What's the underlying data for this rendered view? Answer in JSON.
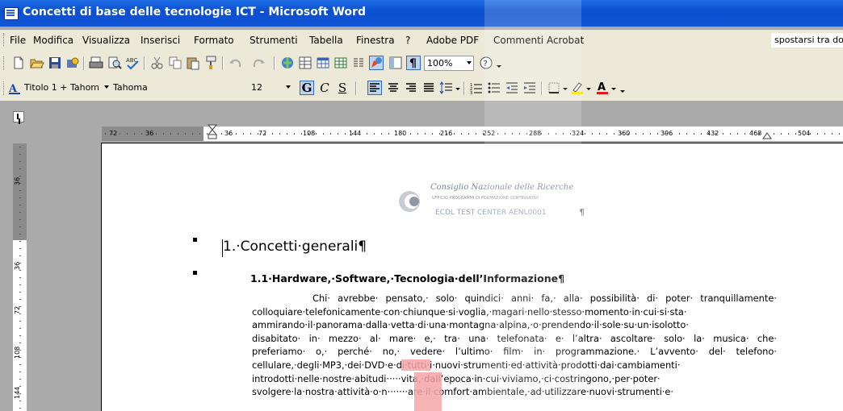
{
  "window": {
    "title": "Concetti di base delle tecnologie ICT - Microsoft Word"
  },
  "menubar": {
    "items": [
      "File",
      "Modifica",
      "Visualizza",
      "Inserisci",
      "Formato",
      "Strumenti",
      "Tabella",
      "Finestra",
      "?",
      "Adobe PDF",
      "Commenti Acrobat"
    ],
    "help_box": "spostarsi tra do"
  },
  "toolbar_standard": {
    "icons": [
      "new-icon",
      "open-icon",
      "save-icon",
      "permission-icon",
      "print-icon",
      "print-preview-icon",
      "spelling-icon",
      "cut-icon",
      "copy-icon",
      "paste-icon",
      "format-painter-icon",
      "undo-icon",
      "redo-icon",
      "hyperlink-icon",
      "tables-borders-icon",
      "insert-table-icon",
      "insert-excel-icon",
      "columns-icon",
      "drawing-icon",
      "document-map-icon",
      "show-formatting-icon",
      "help-icon"
    ],
    "zoom": "100%"
  },
  "toolbar_formatting": {
    "style": "Titolo 1 + Tahom",
    "font": "Tahoma",
    "size": "12",
    "bold_label": "G",
    "italic_label": "C",
    "underline_label": "S"
  },
  "rulers": {
    "horizontal": [
      "72",
      "36",
      "36",
      "72",
      "108",
      "144",
      "180",
      "216",
      "252",
      "288",
      "324",
      "360",
      "396",
      "432",
      "468",
      "504"
    ],
    "vertical": [
      "36",
      "36",
      "72",
      "108",
      "144"
    ]
  },
  "logo": {
    "line1": "Consiglio Nazionale delle Ricerche",
    "line2": "UFFICIO PROGRAMMI DI FORMAZIONE CONTINUATIVI",
    "line3": "ECDL TEST CENTER AENL0001",
    "mark": "¶"
  },
  "document": {
    "heading1": "1.·Concetti·generali¶",
    "heading2": "1.1·Hardware,·Software,·Tecnologia·dell’Informazione¶",
    "paragraph_lines": [
      "Chi· avrebbe· pensato,· solo· quindici· anni· fa,· alla· possibilità· di· poter· tranquillamente·",
      "colloquiare·telefonicamente·con·chiunque·si·voglia,·magari·nello·stesso·momento·in·cui·si·sta·",
      "ammirando·il·panorama·dalla·vetta·di·una·montagna·alpina,·o·prendendo·il·sole·su·un·isolotto·",
      "disabitato· in· mezzo· al· mare· e,· tra· una· telefonata· e· l’altra· ascoltare· solo· la· musica· che·",
      "preferiamo· o,· perché· no,· vedere· l’ultimo· film· in· programmazione.· L’avvento· del· telefono·",
      "cellulare,·degli·MP3,·dei·DVD·e·di·tutti·i·nuovi·strumenti·ed·attività·prodotti·dai·cambiamenti·",
      "introdotti·nelle·nostre·abitudi·····vita,·dall’epoca·in·cui·viviamo,·ci·costringono,·per·poter·",
      "svolgere·la·nostra·attività·o·n·······are·il·comfort·ambientale,·ad·utilizzare·nuovi·strumenti·e·"
    ]
  }
}
